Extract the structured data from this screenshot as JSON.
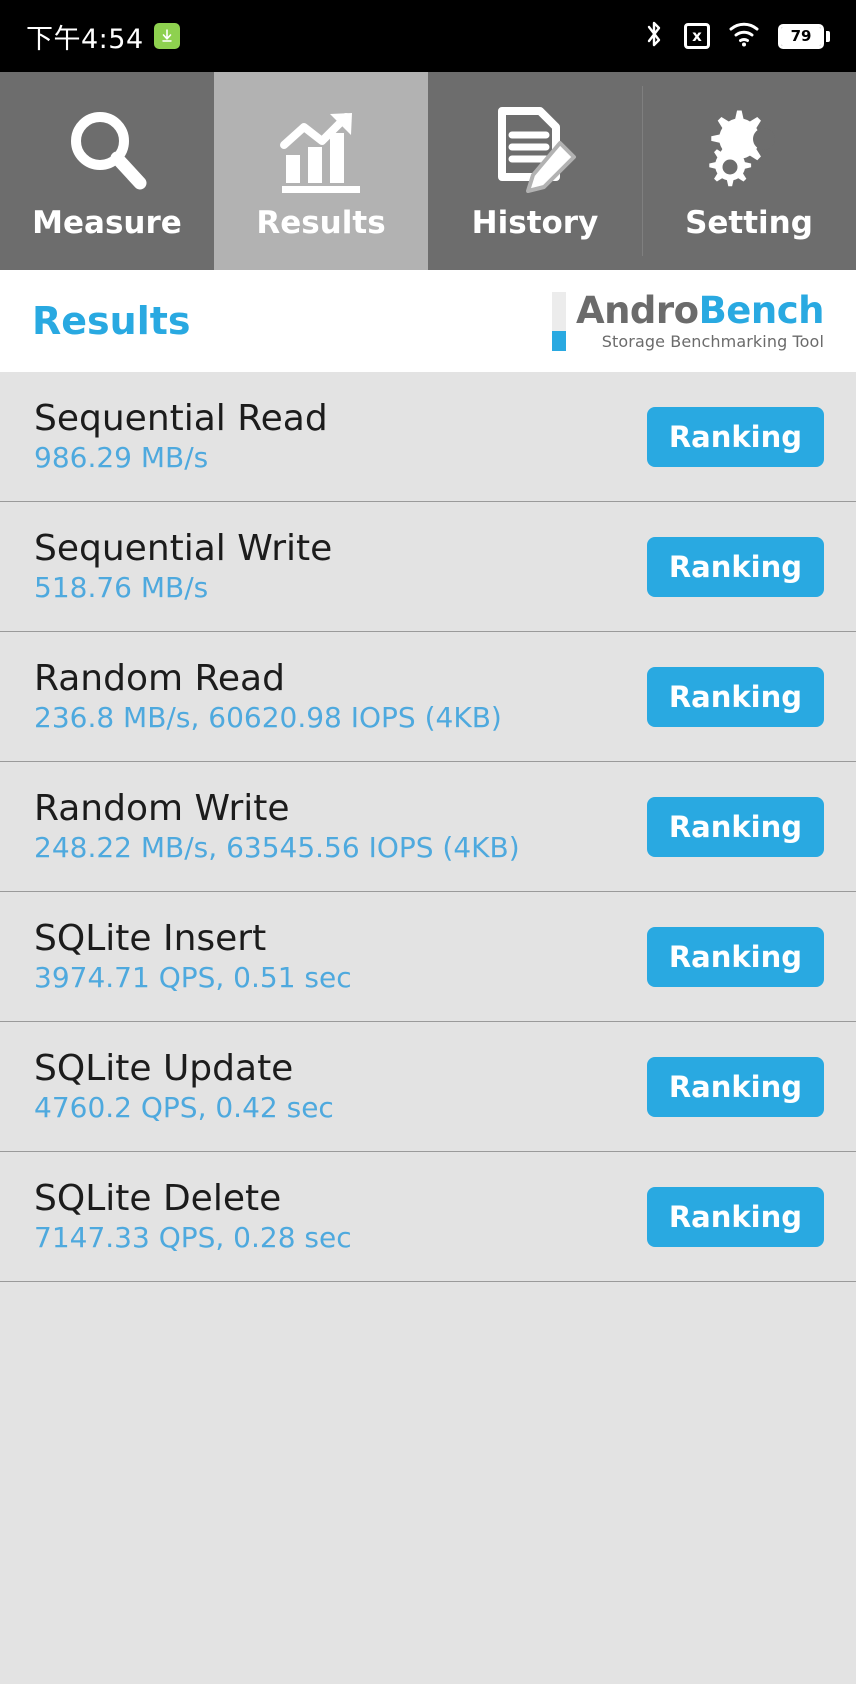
{
  "statusbar": {
    "time": "下午4:54",
    "download_badge_icon": "download-arrow-icon",
    "bluetooth_icon": "bluetooth-icon",
    "sim_label": "x",
    "wifi_icon": "wifi-icon",
    "battery_level": "79"
  },
  "tabs": [
    {
      "label": "Measure",
      "icon": "magnifier-icon",
      "active": false
    },
    {
      "label": "Results",
      "icon": "bar-chart-arrow-icon",
      "active": true
    },
    {
      "label": "History",
      "icon": "document-pencil-icon",
      "active": false
    },
    {
      "label": "Setting",
      "icon": "gears-icon",
      "active": false
    }
  ],
  "header": {
    "title": "Results",
    "logo_primary": "Andro",
    "logo_secondary": "Bench",
    "logo_tagline": "Storage Benchmarking Tool"
  },
  "colors": {
    "accent": "#29a9e1",
    "value_text": "#4ea9de",
    "tab_inactive": "#6d6d6d",
    "tab_active": "#b2b2b2",
    "list_bg": "#e3e3e3",
    "badge_green": "#8ed14f"
  },
  "results": {
    "ranking_label": "Ranking",
    "rows": [
      {
        "title": "Sequential Read",
        "value": "986.29 MB/s"
      },
      {
        "title": "Sequential Write",
        "value": "518.76 MB/s"
      },
      {
        "title": "Random Read",
        "value": "236.8 MB/s, 60620.98 IOPS (4KB)"
      },
      {
        "title": "Random Write",
        "value": "248.22 MB/s, 63545.56 IOPS (4KB)"
      },
      {
        "title": "SQLite Insert",
        "value": "3974.71 QPS, 0.51 sec"
      },
      {
        "title": "SQLite Update",
        "value": "4760.2 QPS, 0.42 sec"
      },
      {
        "title": "SQLite Delete",
        "value": "7147.33 QPS, 0.28 sec"
      }
    ]
  }
}
